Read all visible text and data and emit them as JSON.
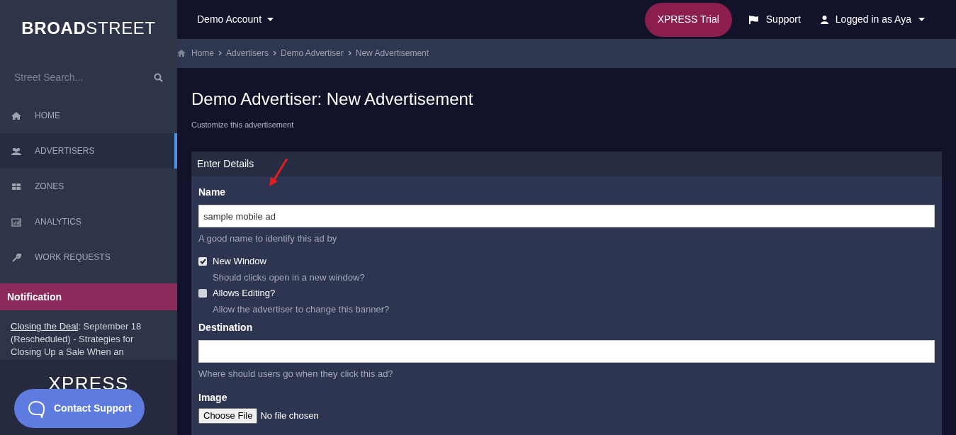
{
  "logo": {
    "bold": "BROAD",
    "light": "STREET"
  },
  "account_menu": {
    "label": "Demo Account"
  },
  "top_actions": [
    {
      "kind": "pill",
      "label": "XPRESS Trial"
    },
    {
      "kind": "flag",
      "label": "Support"
    },
    {
      "kind": "user",
      "label": "Logged in as Aya"
    }
  ],
  "search": {
    "placeholder": "Street Search..."
  },
  "breadcrumb": [
    "Home",
    "Advertisers",
    "Demo Advertiser",
    "New Advertisement"
  ],
  "sidebar": {
    "items": [
      {
        "label": "HOME",
        "selected": false
      },
      {
        "label": "ADVERTISERS",
        "selected": true
      },
      {
        "label": "ZONES",
        "selected": false
      },
      {
        "label": "ANALYTICS",
        "selected": false
      },
      {
        "label": "WORK REQUESTS",
        "selected": false
      }
    ]
  },
  "notification": {
    "title": "Notification",
    "link": "Closing the Deal",
    "text": ": September 18 (Rescheduled) - Strategies for Closing Up a Sale When an"
  },
  "promo": {
    "text": "XPRESS"
  },
  "contact_button": {
    "label": "Contact Support"
  },
  "page": {
    "title": "Demo Advertiser: New Advertisement",
    "subtitle": "Customize this advertisement"
  },
  "panel": {
    "title": "Enter Details",
    "fields": [
      {
        "kind": "text",
        "label": "Name",
        "value": "sample mobile ad",
        "help": "A good name to identify this ad by"
      },
      {
        "kind": "checkbox",
        "label": "New Window",
        "checked": true,
        "help": "Should clicks open in a new window?"
      },
      {
        "kind": "checkbox",
        "label": "Allows Editing?",
        "checked": false,
        "help": "Allow the advertiser to change this banner?"
      },
      {
        "kind": "text",
        "label": "Destination",
        "help": "Where should users go when they click this ad?"
      },
      {
        "kind": "file",
        "label": "Image",
        "button": "Choose File",
        "status": "No file chosen"
      }
    ]
  }
}
